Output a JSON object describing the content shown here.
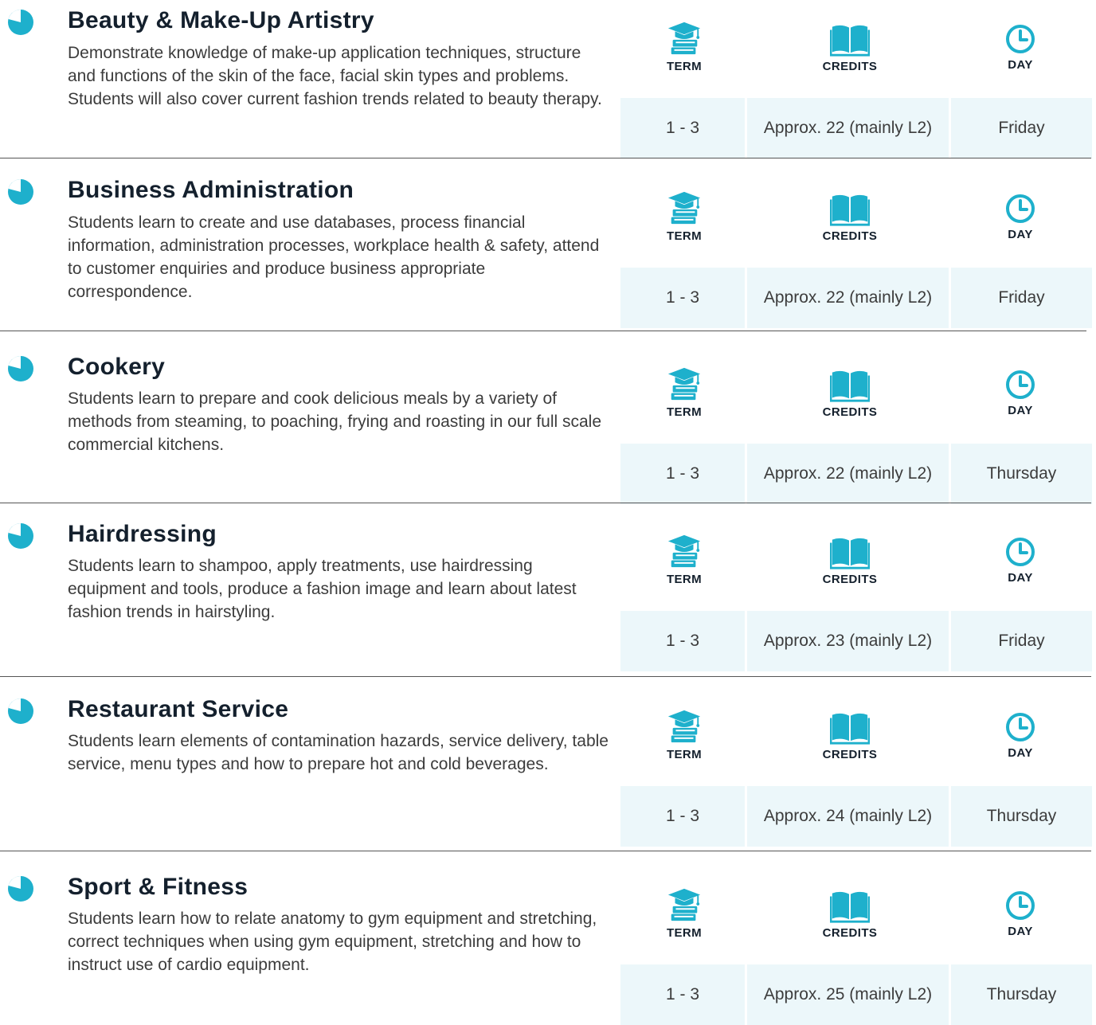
{
  "colors": {
    "accent": "#1eb0cc",
    "title": "#14202d",
    "cell_bg": "#ecf7fa"
  },
  "icons": {
    "bullet": "pie-bullet-icon",
    "term": "graduation-cap-books-icon",
    "credits": "open-book-icon",
    "day": "clock-icon"
  },
  "courses": [
    {
      "title": "Beauty & Make-Up Artistry",
      "description": "Demonstrate knowledge of make-up application techniques, structure and functions of the skin of the face, facial skin types and problems. Students will also cover current fashion trends related to beauty therapy.",
      "term_label": "TERM",
      "credits_label": "CREDITS",
      "day_label": "DAY",
      "term": "1 - 3",
      "credits": "Approx. 22 (mainly L2)",
      "day": "Friday"
    },
    {
      "title": "Business Administration",
      "description": "Students learn to create and use databases, process financial information, administration processes, workplace health & safety, attend to customer enquiries and produce business appropriate correspondence.",
      "term_label": "TERM",
      "credits_label": "CREDITS",
      "day_label": "DAY",
      "term": "1 - 3",
      "credits": "Approx. 22 (mainly L2)",
      "day": "Friday"
    },
    {
      "title": "Cookery",
      "description": "Students learn to prepare and cook delicious meals by a variety of methods from steaming, to poaching, frying and roasting in our full scale commercial kitchens.",
      "term_label": "TERM",
      "credits_label": "CREDITS",
      "day_label": "DAY",
      "term": "1 - 3",
      "credits": "Approx. 22 (mainly L2)",
      "day": "Thursday"
    },
    {
      "title": "Hairdressing",
      "description": "Students learn to shampoo, apply treatments, use hairdressing equipment and tools, produce a fashion image and learn about latest fashion trends in hairstyling.",
      "term_label": "TERM",
      "credits_label": "CREDITS",
      "day_label": "DAY",
      "term": "1 - 3",
      "credits": "Approx. 23 (mainly L2)",
      "day": "Friday"
    },
    {
      "title": "Restaurant Service",
      "description": "Students learn elements of contamination hazards, service delivery, table service, menu types and how to prepare hot and cold beverages.",
      "term_label": "TERM",
      "credits_label": "CREDITS",
      "day_label": "DAY",
      "term": "1 - 3",
      "credits": "Approx. 24 (mainly L2)",
      "day": "Thursday"
    },
    {
      "title": "Sport & Fitness",
      "description": "Students learn how to relate anatomy to gym equipment and stretching, correct techniques when using gym equipment, stretching and how to instruct use of cardio equipment.",
      "term_label": "TERM",
      "credits_label": "CREDITS",
      "day_label": "DAY",
      "term": "1 - 3",
      "credits": "Approx. 25 (mainly L2)",
      "day": "Thursday"
    }
  ]
}
